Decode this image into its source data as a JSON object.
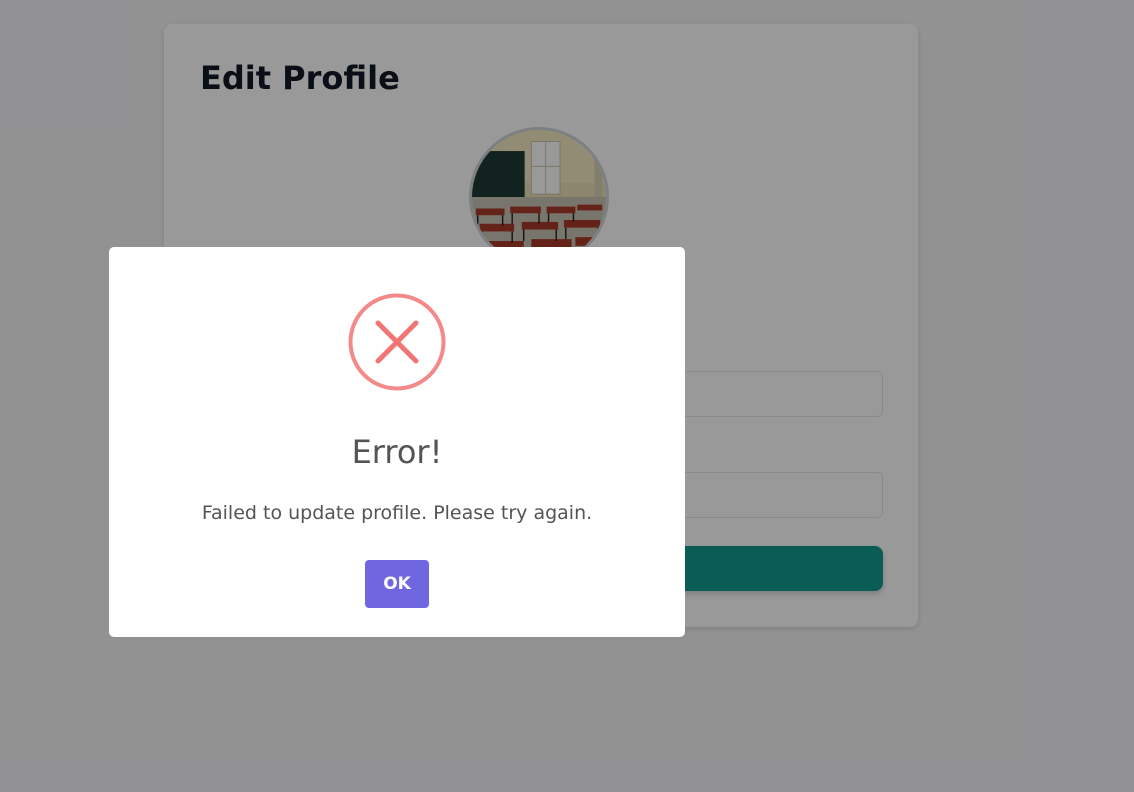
{
  "profile_card": {
    "title": "Edit Profile"
  },
  "dialog": {
    "icon": "error-x-circle-icon",
    "title": "Error!",
    "message": "Failed to update profile. Please try again.",
    "confirm_label": "OK"
  },
  "colors": {
    "error_icon": "#f27474",
    "confirm_button": "#7066e0",
    "save_button": "#0f9b8e",
    "overlay": "rgba(0,0,0,0.4)"
  }
}
